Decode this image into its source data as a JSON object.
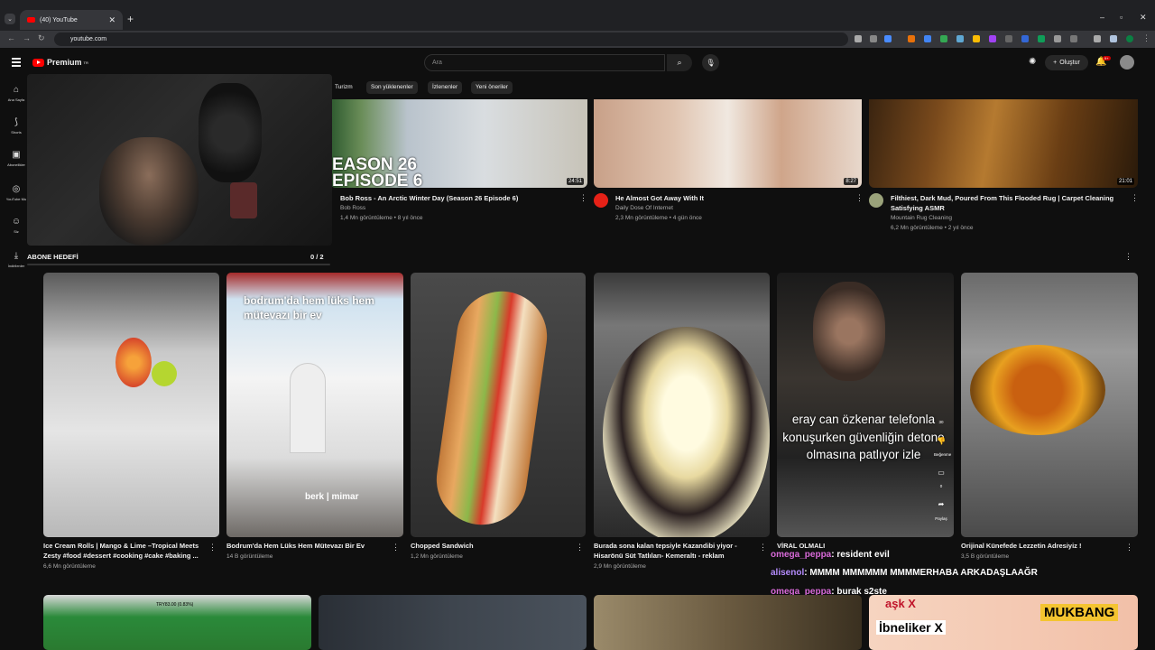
{
  "browser": {
    "tab_title": "(40) YouTube",
    "url": "youtube.com"
  },
  "header": {
    "logo_text": "Premium",
    "logo_sup": "TR",
    "search_placeholder": "Ara",
    "create_label": "Oluştur",
    "notif_badge": "9+"
  },
  "sidebar": [
    {
      "label": "Ana Sayfa",
      "icon": "home-icon"
    },
    {
      "label": "Shorts",
      "icon": "shorts-icon"
    },
    {
      "label": "Abonelikler",
      "icon": "subscriptions-icon"
    },
    {
      "label": "YouTube Mu",
      "icon": "music-icon"
    },
    {
      "label": "Siz",
      "icon": "you-icon"
    },
    {
      "label": "İndirilenler",
      "icon": "download-icon"
    }
  ],
  "chips": [
    "Turizm",
    "Son yüklenenler",
    "İzlenenler",
    "Yeni öneriler"
  ],
  "videos_top": [
    {
      "title": "Bob Ross - An Arctic Winter Day (Season 26 Episode 6)",
      "channel": "Bob Ross",
      "meta": "1,4 Mn görüntüleme • 8 yıl önce",
      "duration": "24:51",
      "thumb_text": "EASON 26\nEPISODE 6"
    },
    {
      "title": "He Almost Got Away With It",
      "channel": "Daily Dose Of Internet",
      "meta": "2,3 Mn görüntüleme • 4 gün önce",
      "duration": "8:27"
    },
    {
      "title_line1": "Filthiest, Dark Mud, Poured From This Flooded Rug | Carpet Cleaning",
      "title_line2": "Satisfying ASMR",
      "channel": "Mountain Rug Cleaning",
      "meta": "6,2 Mn görüntüleme • 2 yıl önce",
      "duration": "21:01"
    }
  ],
  "overlay": {
    "abone_label": "ABONE HEDEFİ",
    "abone_count": "0 / 2"
  },
  "shorts": [
    {
      "title_line1": "Ice Cream Rolls | Mango & Lime –Tropical Meets",
      "title_line2": "Zesty #food #dessert #cooking #cake #baking ...",
      "views": "6,6 Mn görüntüleme"
    },
    {
      "title": "Bodrum'da Hem Lüks Hem Mütevazı Bir Ev",
      "views": "14 B görüntüleme",
      "overlay_text": "bodrum'da hem lüks hem mütevazı bir ev",
      "credit": "berk | mimar"
    },
    {
      "title": "Chopped Sandwich",
      "views": "1,2 Mn görüntüleme"
    },
    {
      "title_line1": "Burada sona kalan tepsiyle Kazandibi yiyor -",
      "title_line2": "Hisarönü Süt Tatlıları- Kemeraltı - reklam",
      "views": "2,9 Mn görüntüleme"
    },
    {
      "title": "VİRAL OLMALI",
      "overlay_text": "eray can özkenar telefonla konuşurken güvenliğin detone olmasına patlıyor izle",
      "like_count": "30",
      "like_label": "Beğenme",
      "comment_count": "0",
      "share_label": "Paylaş"
    },
    {
      "title": "Orijinal Künefede Lezzetin Adresiyiz !",
      "views": "3,5 B görüntüleme"
    }
  ],
  "chat": [
    {
      "user": "omega_peppa",
      "msg": ": resident evil"
    },
    {
      "user": "alisenol",
      "msg": ": MMMM MMMMMM MMMMERHABA ARKADAŞLAAĞR"
    },
    {
      "user": "omega_peppa",
      "msg": ": burak s2ste"
    }
  ],
  "bottom_row": {
    "game_text": "TRY83.00 (0.83%)",
    "mukbang_text1": "aşk X",
    "mukbang_text2": "İbneliker X",
    "mukbang_label": "MUKBANG"
  }
}
